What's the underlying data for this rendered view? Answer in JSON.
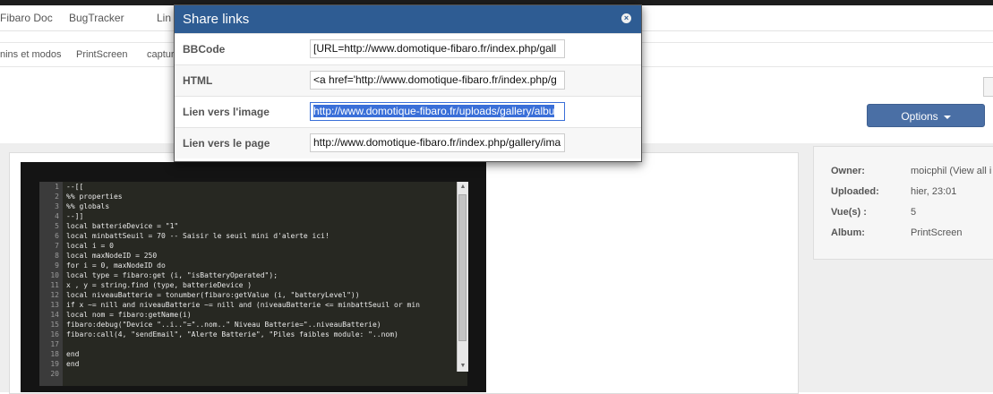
{
  "nav": {
    "items": [
      "Fibaro Doc",
      "BugTracker",
      "Lin"
    ]
  },
  "subnav": {
    "items": [
      "nins et modos",
      "PrintScreen",
      "captur"
    ]
  },
  "options_button": {
    "label": "Options"
  },
  "modal": {
    "title": "Share links",
    "rows": [
      {
        "label": "BBCode",
        "value": "[URL=http://www.domotique-fibaro.fr/index.php/gall"
      },
      {
        "label": "HTML",
        "value": "<a href='http://www.domotique-fibaro.fr/index.php/g"
      },
      {
        "label": "Lien vers l'image",
        "value": "http://www.domotique-fibaro.fr/uploads/gallery/albu"
      },
      {
        "label": "Lien vers le page",
        "value": "http://www.domotique-fibaro.fr/index.php/gallery/ima"
      }
    ]
  },
  "meta": {
    "owner_label": "Owner:",
    "owner_value": "moicphil (View all i",
    "uploaded_label": "Uploaded:",
    "uploaded_value": "hier, 23:01",
    "views_label": "Vue(s) :",
    "views_value": "5",
    "album_label": "Album:",
    "album_value": "PrintScreen"
  },
  "code": {
    "lines": [
      {
        "n": "1",
        "t": "--[["
      },
      {
        "n": "2",
        "t": "%% properties"
      },
      {
        "n": "3",
        "t": "%% globals"
      },
      {
        "n": "4",
        "t": "--]]"
      },
      {
        "n": "5",
        "t": "local batterieDevice = \"1\""
      },
      {
        "n": "6",
        "t": "local minbattSeuil = 70 -- Saisir le seuil mini d'alerte ici!"
      },
      {
        "n": "7",
        "t": "local i = 0"
      },
      {
        "n": "8",
        "t": "local maxNodeID = 250"
      },
      {
        "n": "9",
        "t": "for i = 0, maxNodeID do"
      },
      {
        "n": "10",
        "t": "local type = fibaro:get (i, \"isBatteryOperated\");"
      },
      {
        "n": "11",
        "t": "x , y = string.find (type, batterieDevice )"
      },
      {
        "n": "12",
        "t": "local niveauBatterie = tonumber(fibaro:getValue (i, \"batteryLevel\"))"
      },
      {
        "n": "13",
        "t": "if x ~= nill and niveauBatterie ~= nill and (niveauBatterie <= minbattSeuil or min"
      },
      {
        "n": "14",
        "t": "local nom = fibaro:getName(i)"
      },
      {
        "n": "15",
        "t": "fibaro:debug(\"Device \"..i..\"=\"..nom..\" Niveau Batterie=\"..niveauBatterie)"
      },
      {
        "n": "16",
        "t": "fibaro:call(4, \"sendEmail\", \"Alerte Batterie\", \"Piles faibles module: \"..nom)"
      },
      {
        "n": "17",
        "t": ""
      },
      {
        "n": "18",
        "t": "end"
      },
      {
        "n": "19",
        "t": "end"
      },
      {
        "n": "20",
        "t": ""
      }
    ]
  }
}
